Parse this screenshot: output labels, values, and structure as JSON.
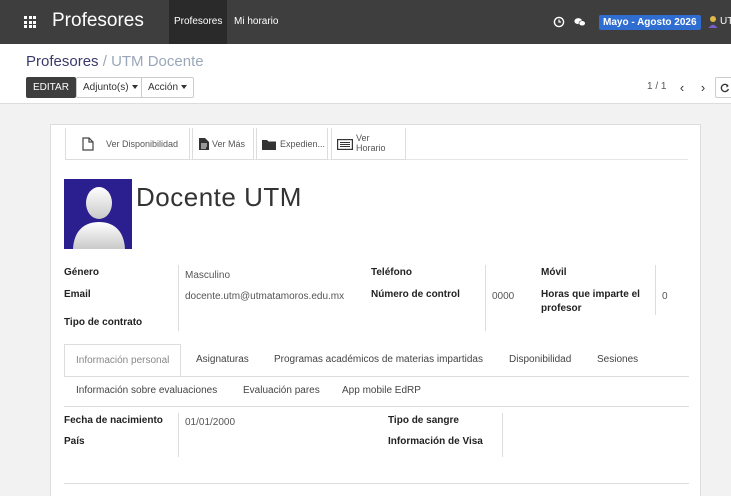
{
  "topbar": {
    "app_title": "Profesores",
    "menus": [
      "Profesores",
      "Mi horario"
    ],
    "period": "Mayo - Agosto 2026",
    "user": "UT",
    "colors": {
      "bar": "#3e3e3e",
      "badge": "#2f6dd0"
    }
  },
  "breadcrumb": {
    "parent": "Profesores",
    "separator": "/",
    "current": "UTM Docente"
  },
  "toolbar": {
    "edit": "EDITAR",
    "attachments": "Adjunto(s)",
    "action": "Acción"
  },
  "pager": {
    "value": "1 / 1"
  },
  "smart_buttons": {
    "availability": "Ver Disponibilidad",
    "more": "Ver Más",
    "file": "Expedien...",
    "schedule_1": "Ver",
    "schedule_2": "Horario"
  },
  "teacher": {
    "name": "Docente  UTM",
    "gender_label": "Género",
    "gender": "Masculino",
    "email_label": "Email",
    "email": "docente.utm@utmatamoros.edu.mx",
    "contract_label": "Tipo de contrato",
    "phone_label": "Teléfono",
    "control_label": "Número de control",
    "control": "0000",
    "mobile_label": "Móvil",
    "hours_label_1": "Horas que imparte el",
    "hours_label_2": "profesor",
    "hours": "0"
  },
  "tabs": [
    "Información personal",
    "Asignaturas",
    "Programas académicos de materias impartidas",
    "Disponibilidad",
    "Sesiones",
    "Información sobre evaluaciones",
    "Evaluación pares",
    "App mobile EdRP"
  ],
  "personal": {
    "birth_label": "Fecha de nacimiento",
    "birth": "01/01/2000",
    "country_label": "País",
    "blood_label": "Tipo de sangre",
    "visa_label": "Información de Visa"
  }
}
